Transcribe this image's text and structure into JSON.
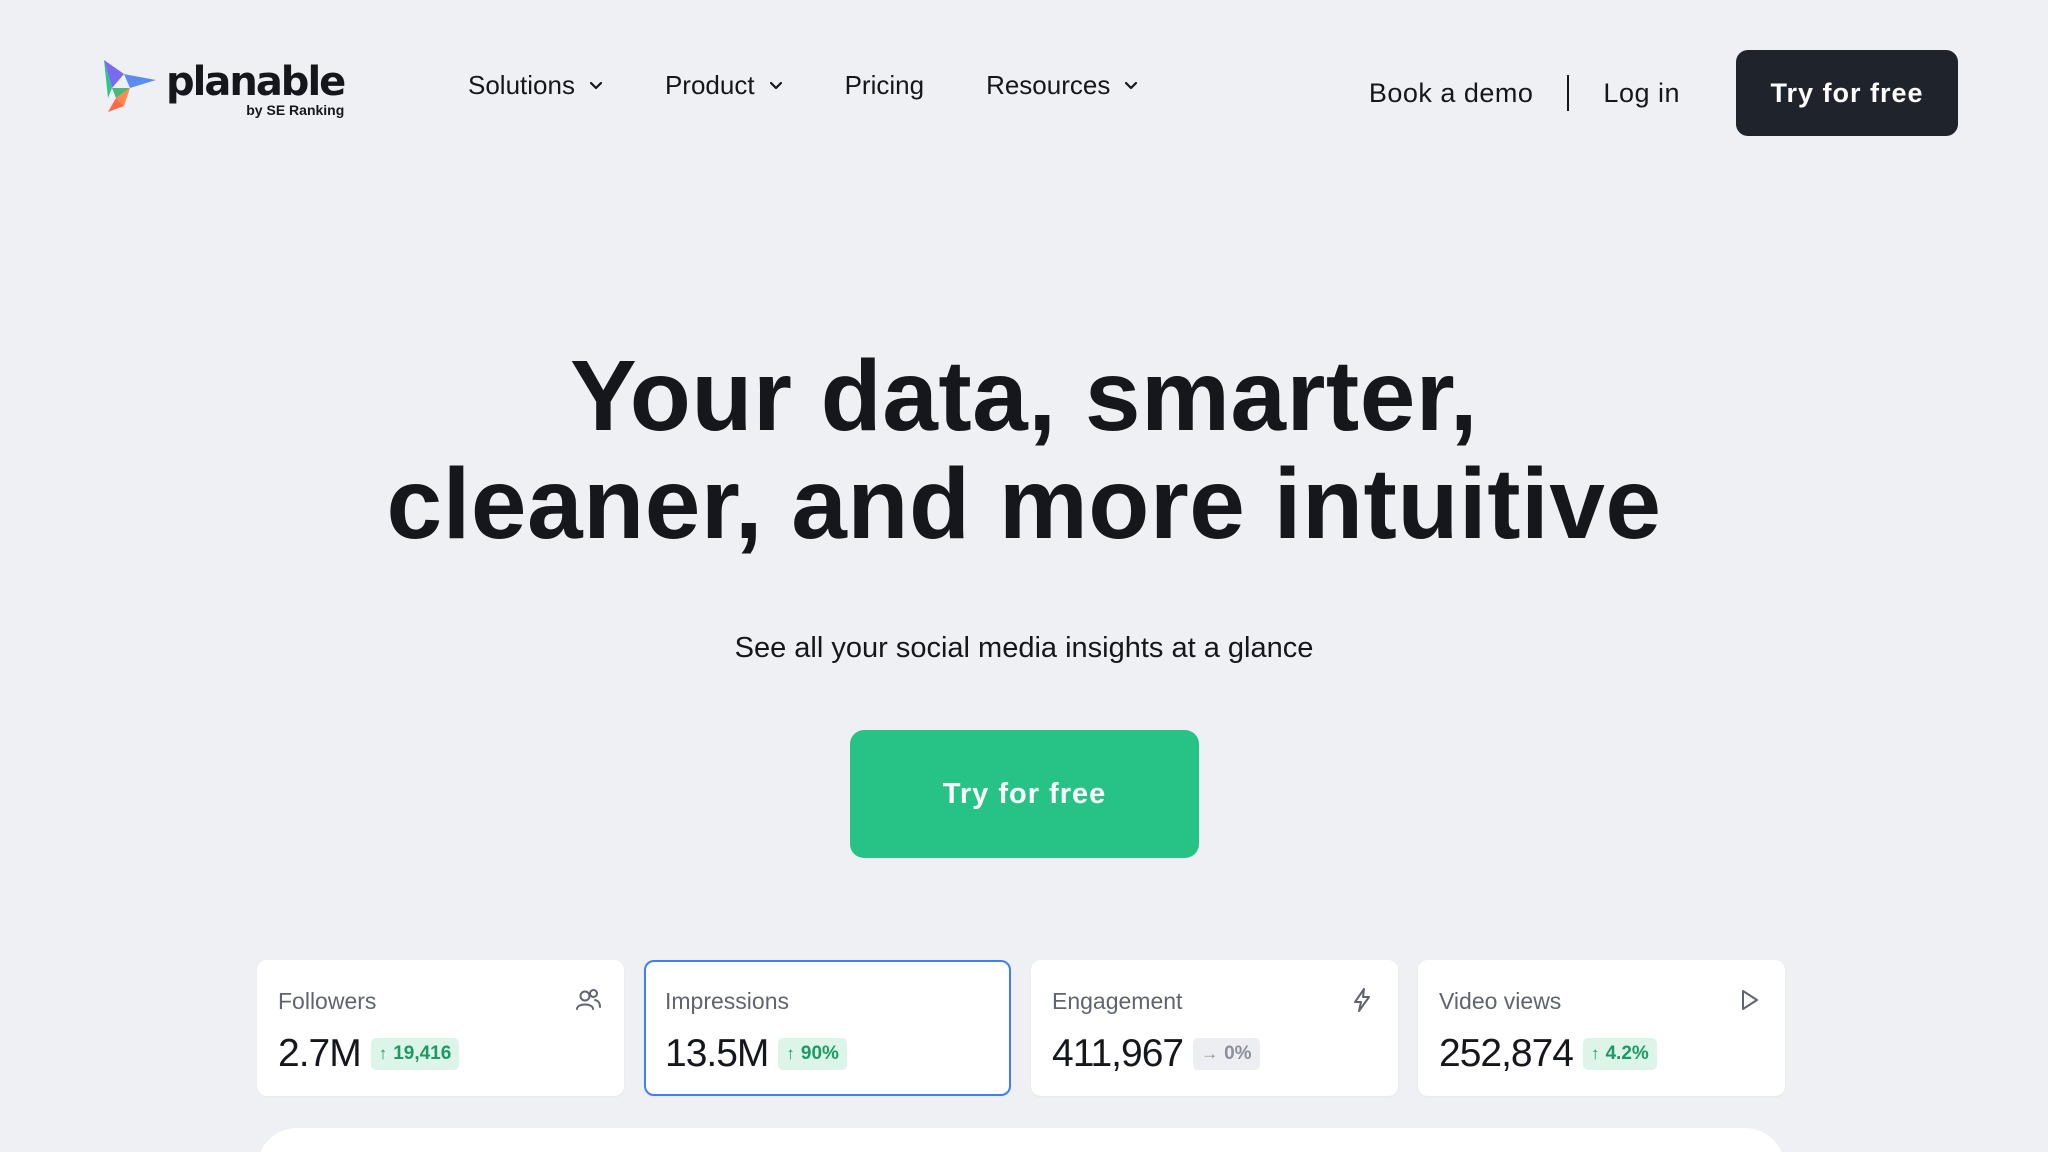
{
  "brand": {
    "name": "planable",
    "sub": "by SE Ranking"
  },
  "nav": {
    "items": [
      {
        "label": "Solutions",
        "has_dropdown": true
      },
      {
        "label": "Product",
        "has_dropdown": true
      },
      {
        "label": "Pricing",
        "has_dropdown": false
      },
      {
        "label": "Resources",
        "has_dropdown": true
      }
    ]
  },
  "header": {
    "book_demo": "Book a demo",
    "login": "Log in",
    "cta": "Try for free"
  },
  "hero": {
    "title_line1": "Your data, smarter,",
    "title_line2": "cleaner, and more intuitive",
    "subtitle": "See all your social media insights at a glance",
    "cta": "Try for free"
  },
  "stats": [
    {
      "label": "Followers",
      "value": "2.7M",
      "delta": "19,416",
      "trend": "up",
      "icon": "users-icon"
    },
    {
      "label": "Impressions",
      "value": "13.5M",
      "delta": "90%",
      "trend": "up",
      "icon": ""
    },
    {
      "label": "Engagement",
      "value": "411,967",
      "delta": "0%",
      "trend": "flat",
      "icon": "lightning-icon"
    },
    {
      "label": "Video views",
      "value": "252,874",
      "delta": "4.2%",
      "trend": "up",
      "icon": "play-icon"
    }
  ],
  "colors": {
    "background": "#eef0f4",
    "primary_dark": "#1f232b",
    "accent_green": "#27c386",
    "active_border": "#3d82f2",
    "badge_up_bg": "#dcf5e8",
    "badge_up_text": "#1d9a63"
  }
}
